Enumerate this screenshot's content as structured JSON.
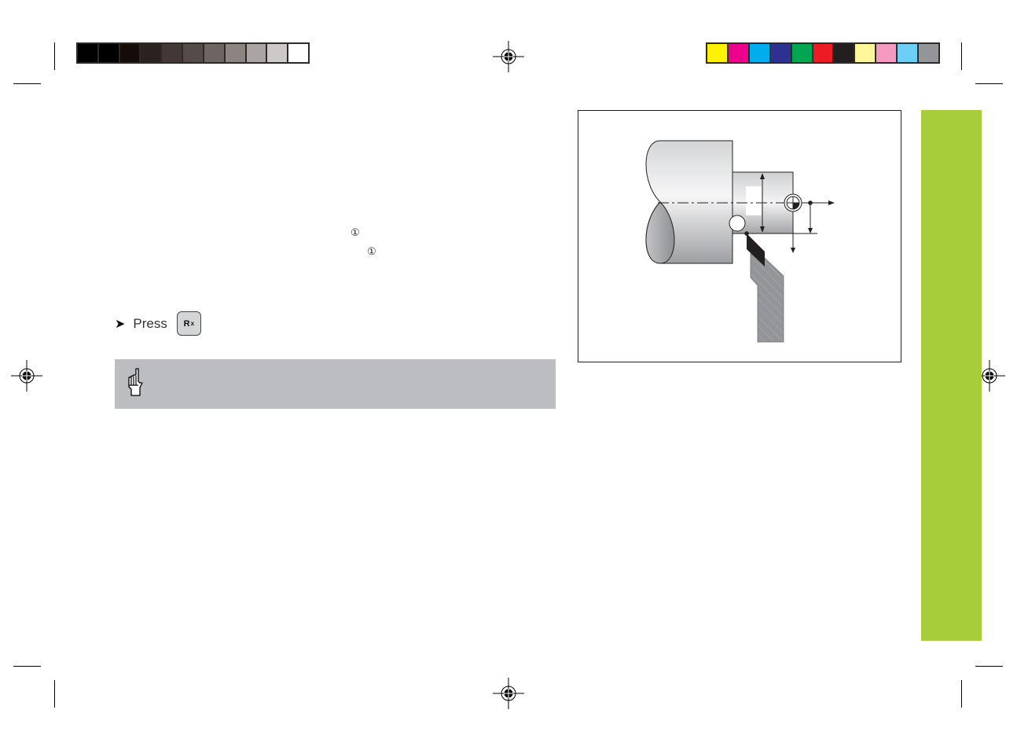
{
  "print_marks": {
    "grayscale_bar": [
      "#000000",
      "#000000",
      "#140c09",
      "#2b2220",
      "#433836",
      "#554b48",
      "#6e6562",
      "#8c8481",
      "#aaa5a3",
      "#cdc9c8",
      "#ffffff"
    ],
    "color_bar": [
      "#fff200",
      "#ec008c",
      "#00aeef",
      "#2e3192",
      "#00a651",
      "#ed1c24",
      "#231f20",
      "#fff799",
      "#f49ac1",
      "#6dcff6",
      "#939598"
    ]
  },
  "content": {
    "callout_markers": [
      "①",
      "①"
    ],
    "press_instruction": {
      "bullet": "➤",
      "label": "Press",
      "key_label": "R",
      "key_subscript": "x"
    },
    "note_box": {
      "icon": "pointing-hand-icon",
      "text": ""
    }
  },
  "figure": {
    "description": "Lathe workpiece with turning tool, tool radius compensation",
    "colors": {
      "tool_tip": "#231f20",
      "tool_shank": "#8e8f92"
    }
  },
  "sidebar": {
    "color": "#a8cd3a"
  }
}
